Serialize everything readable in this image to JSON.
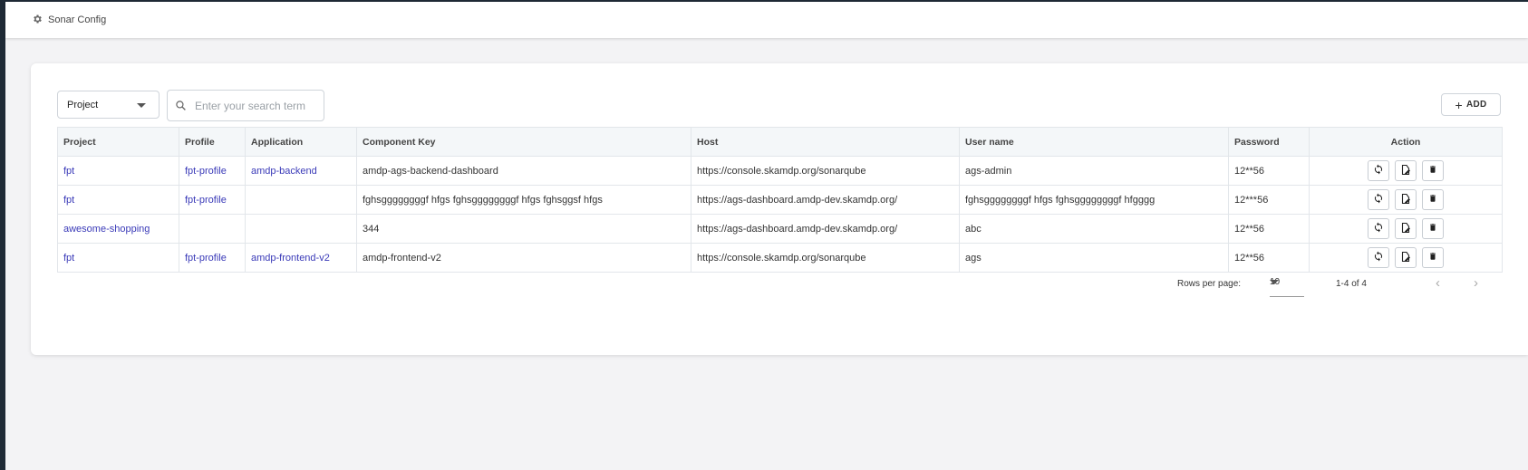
{
  "header": {
    "title": "Sonar Config",
    "icon": "gear-icon"
  },
  "toolbar": {
    "filter_select": "Project",
    "search_placeholder": "Enter your search term",
    "search_value": "",
    "add_label": "ADD"
  },
  "table": {
    "columns": [
      "Project",
      "Profile",
      "Application",
      "Component Key",
      "Host",
      "User name",
      "Password",
      "Action"
    ],
    "rows": [
      {
        "project": "fpt",
        "profile": "fpt-profile",
        "application": "amdp-backend",
        "component_key": "amdp-ags-backend-dashboard",
        "host": "https://console.skamdp.org/sonarqube",
        "username": "ags-admin",
        "password": "12**56"
      },
      {
        "project": "fpt",
        "profile": "fpt-profile",
        "application": "",
        "component_key": "fghsggggggggf hfgs fghsggggggggf hfgs fghsggsf hfgs",
        "host": "https://ags-dashboard.amdp-dev.skamdp.org/",
        "username": "fghsggggggggf hfgs fghsggggggggf hfgggg",
        "password": "12***56"
      },
      {
        "project": "awesome-shopping",
        "profile": "",
        "application": "",
        "component_key": "344",
        "host": "https://ags-dashboard.amdp-dev.skamdp.org/",
        "username": "abc",
        "password": "12**56"
      },
      {
        "project": "fpt",
        "profile": "fpt-profile",
        "application": "amdp-frontend-v2",
        "component_key": "amdp-frontend-v2",
        "host": "https://console.skamdp.org/sonarqube",
        "username": "ags",
        "password": "12**56"
      }
    ]
  },
  "pagination": {
    "rows_per_page_label": "Rows per page:",
    "rows_per_page": "10",
    "range": "1-4 of 4",
    "prev": "‹",
    "next": "›"
  },
  "colors": {
    "link": "#3a3ab8",
    "header_bg": "#f4f7f9",
    "sidebar": "#1f2a36"
  }
}
